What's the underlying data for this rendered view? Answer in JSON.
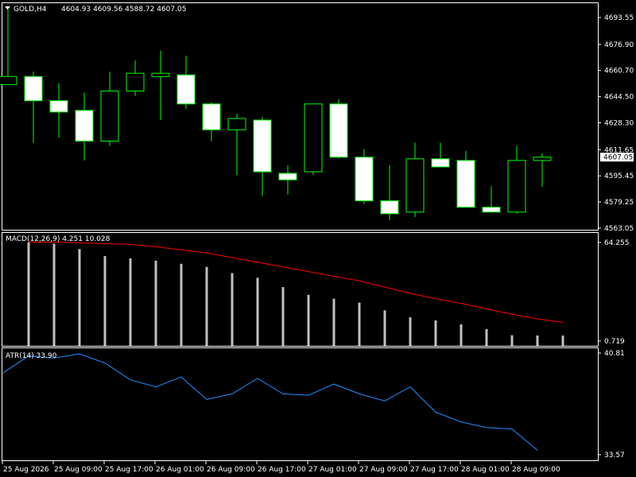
{
  "window": {
    "symbol": "GOLD,H4",
    "ohlc": "4604.93 4609.56 4588.72 4607.05",
    "current_price": "4607.05"
  },
  "colors": {
    "background": "#000000",
    "grid": "#ffffff",
    "candle_up_fill": "#000000",
    "candle_down_fill": "#ffffff",
    "candle_wick": "#00ff00",
    "macd_hist": "#c0c0c0",
    "macd_signal": "#ff0000",
    "atr": "#1e90ff",
    "text": "#ffffff"
  },
  "chart_data": [
    {
      "type": "candlestick",
      "title": "GOLD,H4",
      "ylim": [
        4563.05,
        4703.0
      ],
      "y_ticks": [
        "4693.55",
        "4676.90",
        "4660.70",
        "4644.50",
        "4628.30",
        "4611.65",
        "4595.45",
        "4579.25",
        "4563.05"
      ],
      "candles": [
        {
          "o": 4652,
          "h": 4700,
          "l": 4652,
          "c": 4657
        },
        {
          "o": 4657,
          "h": 4660,
          "l": 4616,
          "c": 4642
        },
        {
          "o": 4642,
          "h": 4653,
          "l": 4619,
          "c": 4635
        },
        {
          "o": 4636,
          "h": 4647,
          "l": 4605,
          "c": 4617
        },
        {
          "o": 4617,
          "h": 4660,
          "l": 4614,
          "c": 4648
        },
        {
          "o": 4648,
          "h": 4667,
          "l": 4645,
          "c": 4659
        },
        {
          "o": 4657,
          "h": 4673,
          "l": 4630,
          "c": 4659
        },
        {
          "o": 4658,
          "h": 4670,
          "l": 4637,
          "c": 4640
        },
        {
          "o": 4640,
          "h": 4641,
          "l": 4617,
          "c": 4624
        },
        {
          "o": 4624,
          "h": 4634,
          "l": 4596,
          "c": 4631
        },
        {
          "o": 4630,
          "h": 4632,
          "l": 4583,
          "c": 4598
        },
        {
          "o": 4597,
          "h": 4602,
          "l": 4584,
          "c": 4593
        },
        {
          "o": 4598,
          "h": 4640,
          "l": 4596,
          "c": 4640
        },
        {
          "o": 4640,
          "h": 4643,
          "l": 4606,
          "c": 4607
        },
        {
          "o": 4607,
          "h": 4612,
          "l": 4578,
          "c": 4580
        },
        {
          "o": 4580,
          "h": 4602,
          "l": 4568,
          "c": 4572
        },
        {
          "o": 4573,
          "h": 4616,
          "l": 4570,
          "c": 4606
        },
        {
          "o": 4606,
          "h": 4616,
          "l": 4601,
          "c": 4601
        },
        {
          "o": 4605,
          "h": 4611,
          "l": 4577,
          "c": 4576
        },
        {
          "o": 4576,
          "h": 4589,
          "l": 4573,
          "c": 4573
        },
        {
          "o": 4573,
          "h": 4614,
          "l": 4572,
          "c": 4605
        },
        {
          "o": 4605,
          "h": 4609.56,
          "l": 4588.72,
          "c": 4607.05
        }
      ]
    },
    {
      "type": "bar",
      "title": "MACD(12,26,9) 4.251 10.028",
      "ylim": [
        0.719,
        64.255
      ],
      "y_ticks": [
        "64.255",
        "0.719"
      ],
      "histogram": [
        64.3,
        63.5,
        60.0,
        55.5,
        54.0,
        52.5,
        50.5,
        48.5,
        44.5,
        41.5,
        35.5,
        30.5,
        28.0,
        25.5,
        20.5,
        16.0,
        14.0,
        11.5,
        8.5,
        4.5,
        4.3,
        4.251
      ],
      "signal": [
        64.5,
        64.5,
        64.0,
        63.5,
        63.0,
        61.5,
        59.5,
        57.5,
        54.5,
        51.5,
        48.5,
        45.5,
        42.5,
        39.5,
        35.5,
        31.5,
        28.0,
        25.0,
        21.5,
        18.0,
        15.0,
        12.8
      ]
    },
    {
      "type": "line",
      "title": "ATR(14) 33.90",
      "ylim": [
        33.57,
        40.81
      ],
      "y_ticks": [
        "40.81",
        "33.57"
      ],
      "values": [
        39.4,
        40.6,
        40.45,
        40.75,
        40.1,
        38.9,
        38.4,
        39.1,
        37.5,
        37.9,
        39.0,
        37.9,
        37.8,
        38.6,
        37.9,
        37.4,
        38.4,
        36.6,
        35.9,
        35.5,
        35.4,
        33.9
      ]
    }
  ],
  "x_axis": {
    "labels": [
      "25 Aug 2026",
      "25 Aug 09:00",
      "25 Aug 17:00",
      "26 Aug 01:00",
      "26 Aug 09:00",
      "26 Aug 17:00",
      "27 Aug 01:00",
      "27 Aug 09:00",
      "27 Aug 17:00",
      "28 Aug 01:00",
      "28 Aug 09:00"
    ]
  }
}
